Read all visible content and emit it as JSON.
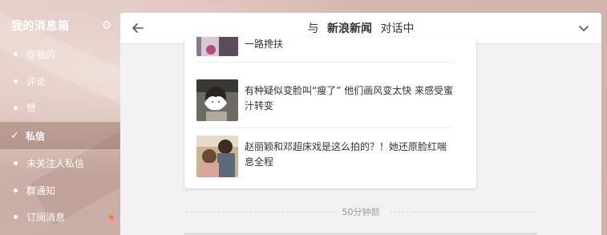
{
  "sidebar": {
    "title": "我的消息箱",
    "settings_icon": "gear-icon",
    "items": [
      {
        "label": "@我的",
        "active": false
      },
      {
        "label": "评论",
        "active": false
      },
      {
        "label": "赞",
        "active": false
      },
      {
        "label": "私信",
        "active": true
      },
      {
        "label": "未关注人私信",
        "active": false
      },
      {
        "label": "群通知",
        "active": false
      },
      {
        "label": "订阅消息",
        "active": false,
        "badge_color": "#ff7a2e"
      }
    ]
  },
  "chat": {
    "header": {
      "prefix": "与",
      "name": "新浪新闻",
      "suffix": "对话中",
      "back_icon": "back-arrow-icon",
      "expand_icon": "chevron-down-icon"
    },
    "news": [
      {
        "title": "一路搀扶"
      },
      {
        "title": "有种疑似变脸叫“瘦了” 他们画风变太快 来感受蜜汁转变"
      },
      {
        "title": "赵丽颖和邓超床戏是这么拍的？！她还原脸红喘息全程"
      }
    ],
    "timestamp": "50分钟前"
  }
}
